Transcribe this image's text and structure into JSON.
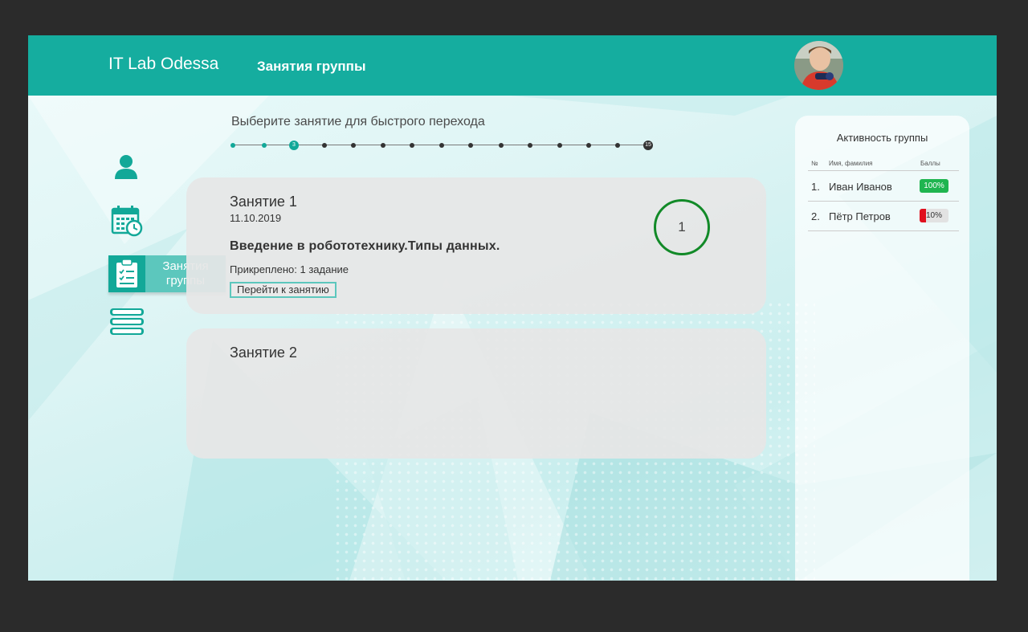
{
  "header": {
    "brand": "IT Lab Odessa",
    "title": "Занятия группы"
  },
  "sidebar": {
    "items": [
      {
        "icon": "user-icon"
      },
      {
        "icon": "calendar-clock-icon"
      },
      {
        "icon": "clipboard-checklist-icon",
        "label_line1": "Занятия",
        "label_line2": "группы",
        "active": true
      },
      {
        "icon": "books-icon"
      }
    ]
  },
  "stepper": {
    "title": "Выберите занятие для быстрого перехода",
    "current": "3",
    "last": "15"
  },
  "lessons": [
    {
      "title": "Занятие 1",
      "date": "11.10.2019",
      "topic": "Введение в робототехнику.Типы данных.",
      "attached": "Прикреплено: 1 задание",
      "button": "Перейти к занятию",
      "count": "1"
    },
    {
      "title": "Занятие 2"
    }
  ],
  "activity": {
    "title": "Активность группы",
    "col_num": "№",
    "col_name": "Имя, фамилия",
    "col_score": "Баллы",
    "rows": [
      {
        "num": "1.",
        "name": "Иван Иванов",
        "score": "100%",
        "value": 1.0,
        "color": "#1fb550"
      },
      {
        "num": "2.",
        "name": "Пётр Петров",
        "score": "10%",
        "value": 0.1,
        "color": "#e0101e"
      }
    ]
  },
  "colors": {
    "accent": "#15ad9f",
    "accent_dark": "#12a898",
    "accent_light": "#5cc7bd",
    "count_ring": "#128a28"
  }
}
